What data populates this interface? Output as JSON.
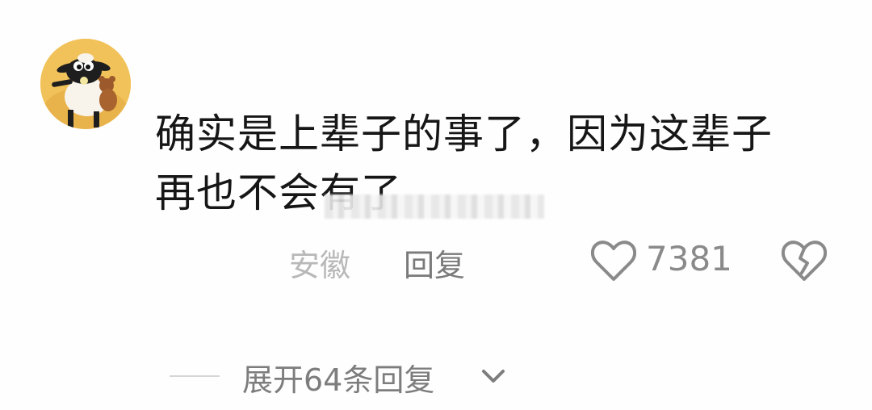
{
  "comment": {
    "text_line1": "确实是上辈子的事了，因为这辈子",
    "text_line2": "再也不会有了",
    "location": "安徽",
    "reply_label": "回复",
    "like_count": "7381",
    "expand_label": "展开64条回复"
  },
  "colors": {
    "text": "#161616",
    "meta": "#b8b8b8",
    "reply": "#7a7a7a",
    "icon": "#8a8a8a",
    "avatar_bg": "#f2c25a"
  },
  "icons": {
    "like": "heart-outline-icon",
    "dislike": "broken-heart-icon",
    "expand": "chevron-down-icon"
  }
}
